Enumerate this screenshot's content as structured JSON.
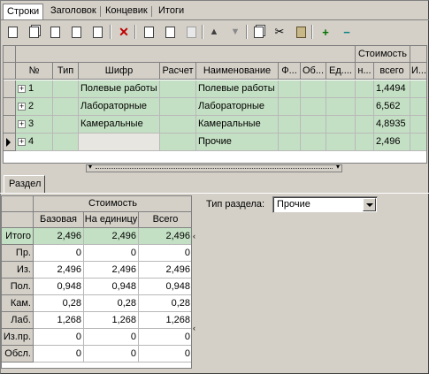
{
  "top_tabs": [
    "Строки",
    "Заголовок",
    "Концевик",
    "Итоги"
  ],
  "grid": {
    "group_header": "Стоимость",
    "columns": [
      "№",
      "Тип",
      "Шифр",
      "Расчет",
      "Наименование",
      "Ф...",
      "Об...",
      "Ед....",
      "н...",
      "всего",
      "И..."
    ],
    "rows": [
      {
        "num": "1",
        "type": "",
        "code": "Полевые работы",
        "calc": "",
        "name": "Полевые работы",
        "total": "1,4494"
      },
      {
        "num": "2",
        "type": "",
        "code": "Лабораторные",
        "calc": "",
        "name": "Лабораторные",
        "total": "6,562"
      },
      {
        "num": "3",
        "type": "",
        "code": "Камеральные",
        "calc": "",
        "name": "Камеральные",
        "total": "4,8935"
      },
      {
        "num": "4",
        "type": "",
        "code": "",
        "calc": "",
        "name": "Прочие",
        "total": "2,496"
      }
    ]
  },
  "section_tab": "Раздел",
  "bottom_table": {
    "group_header": "Стоимость",
    "columns": [
      "Базовая",
      "На единицу",
      "Всего"
    ],
    "rows": [
      {
        "label": "Итого",
        "base": "2,496",
        "unit": "2,496",
        "total": "2,496"
      },
      {
        "label": "Пр.",
        "base": "0",
        "unit": "0",
        "total": "0"
      },
      {
        "label": "Из.",
        "base": "2,496",
        "unit": "2,496",
        "total": "2,496"
      },
      {
        "label": "Пол.",
        "base": "0,948",
        "unit": "0,948",
        "total": "0,948"
      },
      {
        "label": "Кам.",
        "base": "0,28",
        "unit": "0,28",
        "total": "0,28"
      },
      {
        "label": "Лаб.",
        "base": "1,268",
        "unit": "1,268",
        "total": "1,268"
      },
      {
        "label": "Из.пр.",
        "base": "0",
        "unit": "0",
        "total": "0"
      },
      {
        "label": "Обсл.",
        "base": "0",
        "unit": "0",
        "total": "0"
      }
    ]
  },
  "section_type": {
    "label": "Тип раздела:",
    "value": "Прочие"
  },
  "toolbar_icons": [
    "new-doc-icon",
    "copy-doc-icon",
    "doc-icon",
    "doc-icon",
    "doc-move-icon",
    "delete-icon",
    "import-icon",
    "import-icon",
    "disabled-icon",
    "move-up-icon",
    "move-down-icon",
    "copy-icon",
    "cut-icon",
    "paste-icon",
    "expand-icon",
    "collapse-icon"
  ],
  "colors": {
    "row_green": "#c4e0c4",
    "window_bg": "#d4d0c8"
  }
}
